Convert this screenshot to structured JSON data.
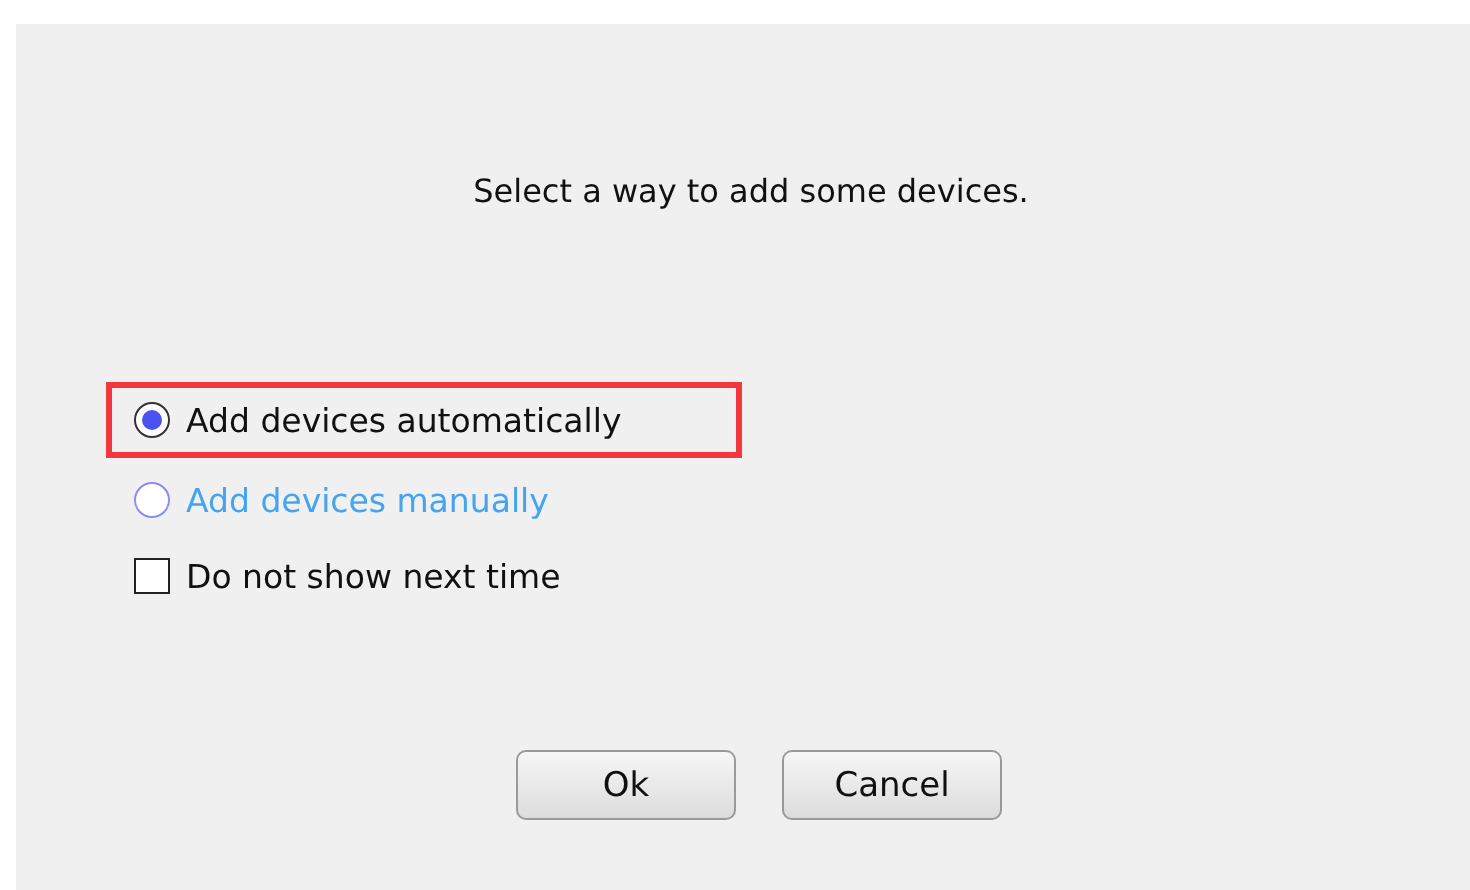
{
  "prompt": "Select a way to add some devices.",
  "options": [
    {
      "label": "Add devices automatically",
      "selected": true,
      "highlighted": true,
      "hovered": false
    },
    {
      "label": "Add devices manually",
      "selected": false,
      "highlighted": false,
      "hovered": true
    }
  ],
  "checkbox": {
    "label": "Do not show next time",
    "checked": false
  },
  "buttons": [
    "Ok",
    "Cancel"
  ]
}
